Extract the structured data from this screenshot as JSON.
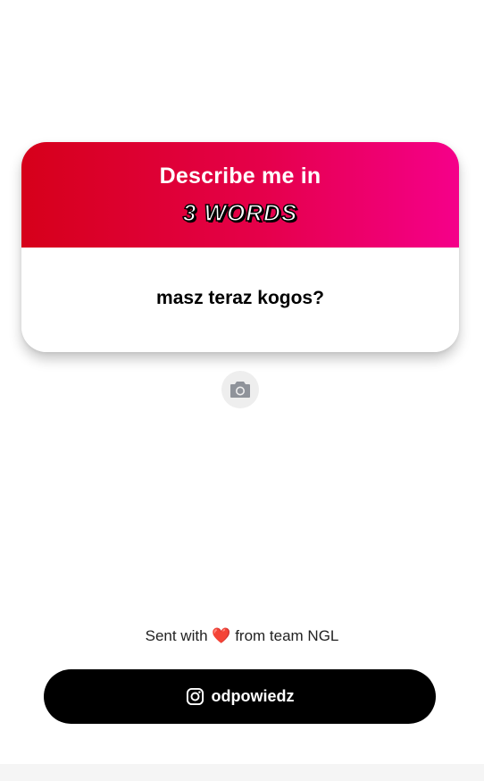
{
  "card": {
    "title": "Describe me in",
    "badge": "3 WORDS",
    "question": "masz teraz kogos?"
  },
  "camera": {
    "icon": "camera-icon"
  },
  "footer": {
    "prefix": "Sent with",
    "heart": "❤️",
    "suffix": "from team NGL"
  },
  "reply_button": {
    "icon": "instagram-icon",
    "label": "odpowiedz"
  },
  "colors": {
    "header_gradient_start": "#d6001a",
    "header_gradient_end": "#f5008a",
    "button_background": "#000000",
    "heart": "#e0262c"
  }
}
